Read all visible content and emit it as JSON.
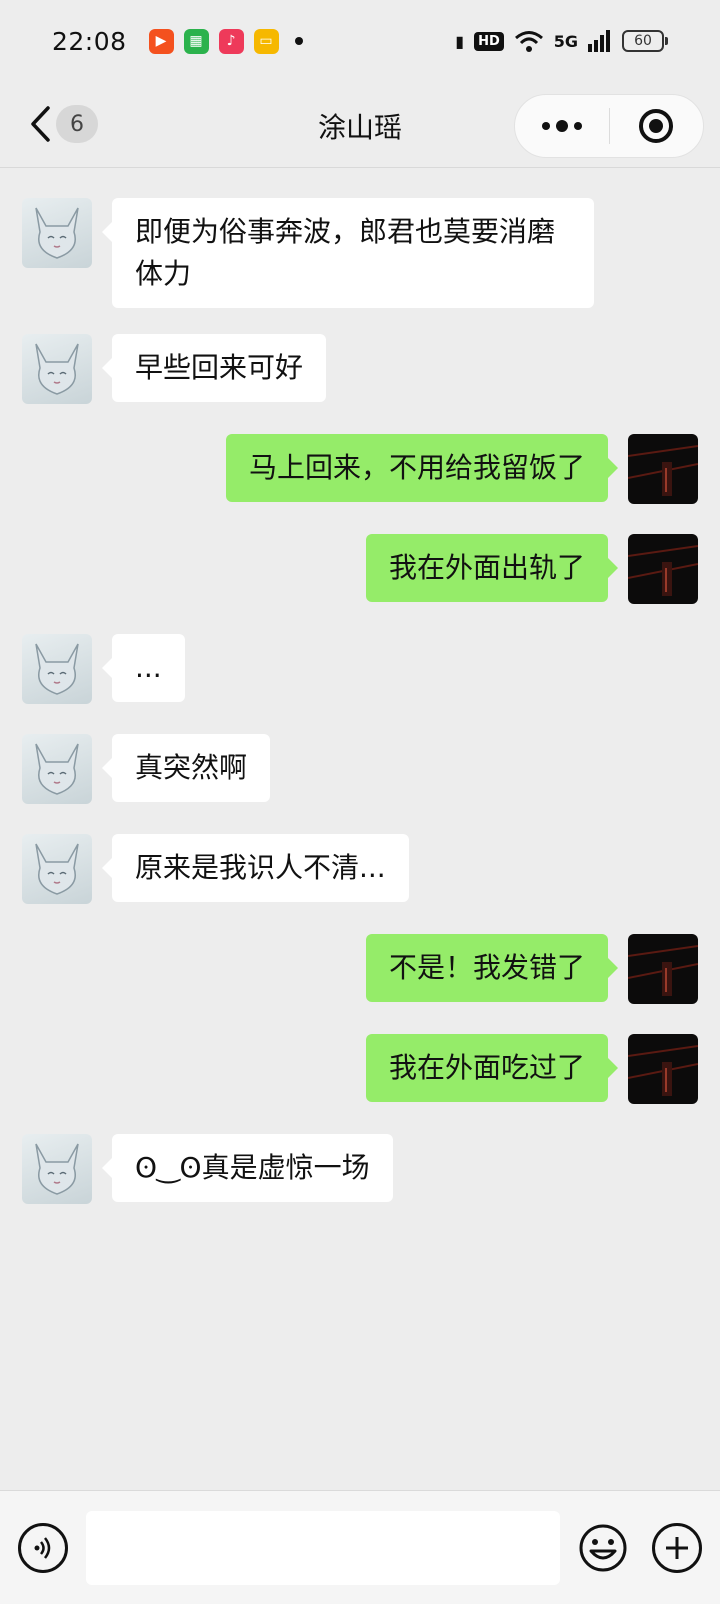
{
  "status_bar": {
    "time": "22:08",
    "network": "5G",
    "hd": "HD",
    "battery": "60",
    "app_icons": [
      {
        "name": "video-app-icon",
        "color": "#f4511e"
      },
      {
        "name": "android-app-icon",
        "color": "#2bb24c"
      },
      {
        "name": "music-app-icon",
        "color": "#ee3a5a"
      },
      {
        "name": "book-app-icon",
        "color": "#f6b800"
      }
    ]
  },
  "header": {
    "title": "涂山瑶",
    "unread_count": "6"
  },
  "messages": [
    {
      "side": "left",
      "text": "即便为俗事奔波，郎君也莫要消磨体力"
    },
    {
      "side": "left",
      "text": "早些回来可好"
    },
    {
      "side": "right",
      "text": "马上回来，不用给我留饭了"
    },
    {
      "side": "right",
      "text": "我在外面出轨了"
    },
    {
      "side": "left",
      "text": "..."
    },
    {
      "side": "left",
      "text": "真突然啊"
    },
    {
      "side": "left",
      "text": "原来是我识人不清..."
    },
    {
      "side": "right",
      "text": "不是！我发错了"
    },
    {
      "side": "right",
      "text": "我在外面吃过了"
    },
    {
      "side": "left",
      "text": "ʘ‿ʘ真是虚惊一场"
    }
  ],
  "input": {
    "value": "",
    "placeholder": ""
  },
  "colors": {
    "outgoing_bubble": "#95ec69",
    "incoming_bubble": "#ffffff",
    "background": "#ededed"
  }
}
